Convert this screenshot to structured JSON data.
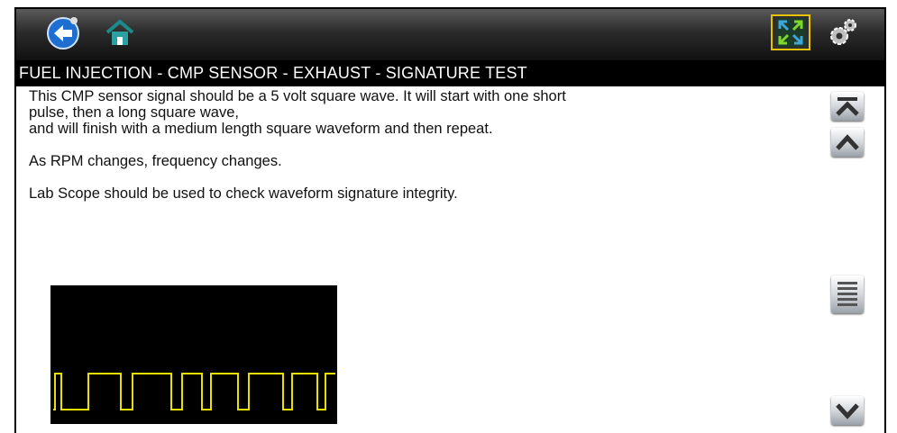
{
  "toolbar": {
    "icons": {
      "back": "back-arrow-icon",
      "home": "home-icon",
      "expand": "expand-icon",
      "settings": "settings-gear-icon"
    }
  },
  "title": "FUEL INJECTION - CMP SENSOR - EXHAUST - SIGNATURE TEST",
  "content": {
    "line1": "This CMP sensor signal should be a 5 volt square wave. It will start with one short",
    "line2": "pulse, then a long square wave,",
    "line3": "and will finish with a medium length square waveform and then repeat.",
    "line4": "As RPM changes, frequency changes.",
    "line5": "Lab Scope should be used to check waveform signature integrity."
  },
  "scrollbar": {
    "icons": [
      "scroll-to-top-icon",
      "scroll-up-icon",
      "scroll-thumb-icon",
      "scroll-down-icon"
    ]
  },
  "colors": {
    "waveform": "#e8e000",
    "toolbar": "#2b2b2b",
    "highlight": "#e6c200"
  }
}
